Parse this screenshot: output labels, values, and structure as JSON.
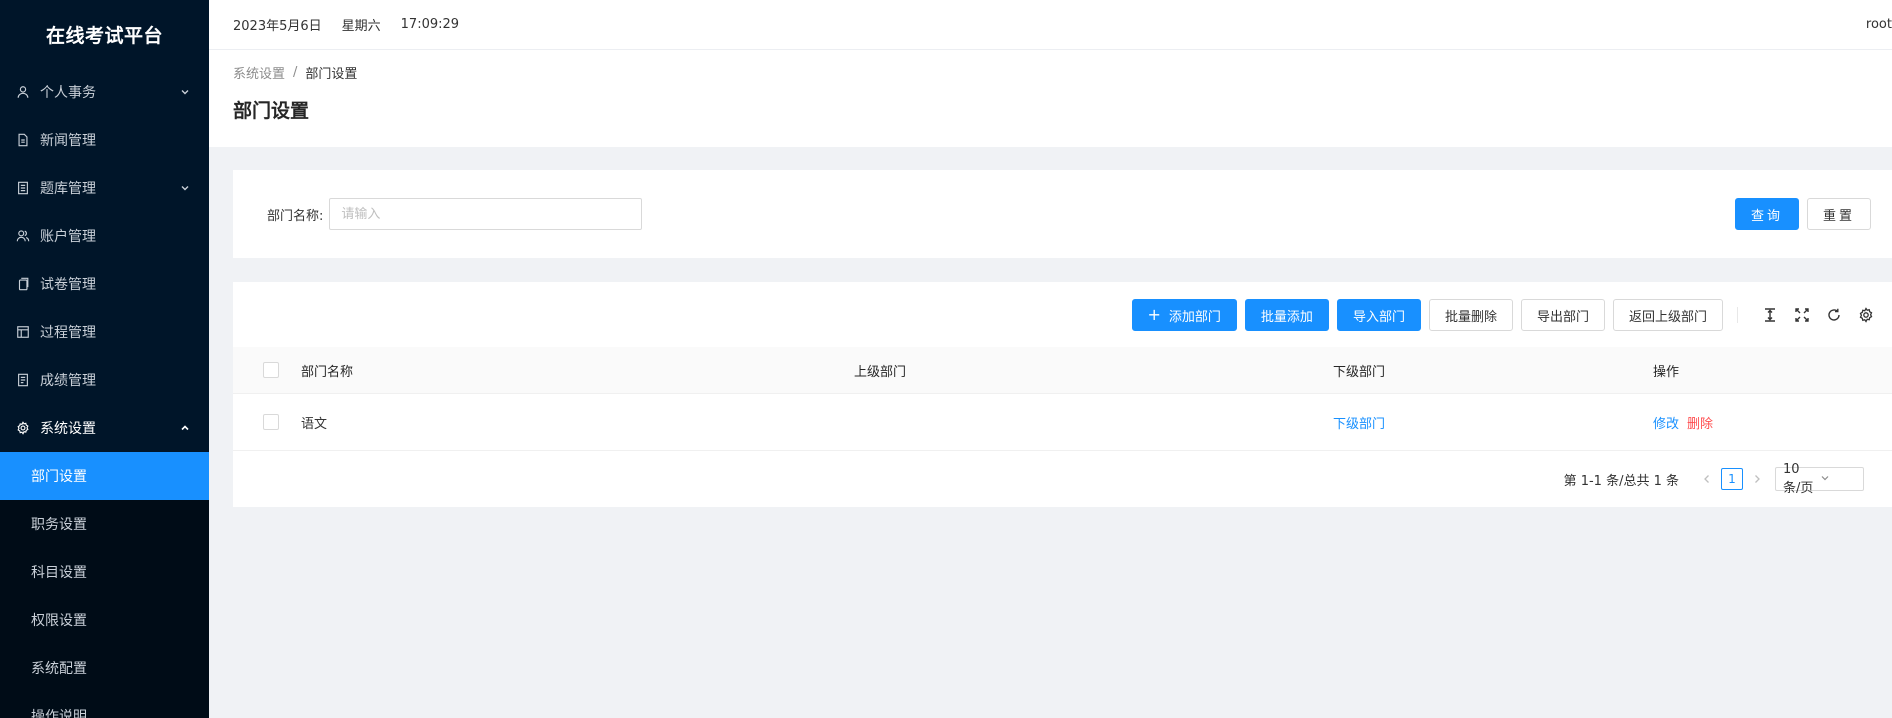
{
  "app": {
    "title": "在线考试平台"
  },
  "sidebar": {
    "items": [
      {
        "label": "个人事务",
        "icon": "user-icon",
        "has_children": true,
        "open": false
      },
      {
        "label": "新闻管理",
        "icon": "file-icon",
        "has_children": false
      },
      {
        "label": "题库管理",
        "icon": "book-icon",
        "has_children": true,
        "open": false
      },
      {
        "label": "账户管理",
        "icon": "users-icon",
        "has_children": false
      },
      {
        "label": "试卷管理",
        "icon": "copy-icon",
        "has_children": false
      },
      {
        "label": "过程管理",
        "icon": "layout-icon",
        "has_children": false
      },
      {
        "label": "成绩管理",
        "icon": "report-icon",
        "has_children": false
      },
      {
        "label": "系统设置",
        "icon": "gear-icon",
        "has_children": true,
        "open": true
      }
    ],
    "submenu": [
      {
        "label": "部门设置",
        "active": true
      },
      {
        "label": "职务设置"
      },
      {
        "label": "科目设置"
      },
      {
        "label": "权限设置"
      },
      {
        "label": "系统配置"
      },
      {
        "label": "操作说明"
      }
    ]
  },
  "header": {
    "date": "2023年5月6日",
    "weekday": "星期六",
    "time": "17:09:29",
    "user": "root"
  },
  "breadcrumb": {
    "parent": "系统设置",
    "separator": "/",
    "current": "部门设置"
  },
  "page": {
    "title": "部门设置"
  },
  "search": {
    "label": "部门名称:",
    "placeholder": "请输入",
    "value": "",
    "query_label": "查询",
    "reset_label": "重置"
  },
  "toolbar": {
    "add_label": "添加部门",
    "batch_add_label": "批量添加",
    "import_label": "导入部门",
    "batch_delete_label": "批量删除",
    "export_label": "导出部门",
    "back_label": "返回上级部门"
  },
  "table": {
    "columns": {
      "name": "部门名称",
      "parent": "上级部门",
      "child": "下级部门",
      "op": "操作"
    },
    "rows": [
      {
        "name": "语文",
        "parent": "",
        "child": "下级部门",
        "edit": "修改",
        "delete": "删除"
      }
    ]
  },
  "pagination": {
    "total_text": "第 1-1 条/总共 1 条",
    "current_page": "1",
    "page_size": "10 条/页"
  },
  "colors": {
    "primary": "#1890ff",
    "danger": "#ff4d4f",
    "sidebar_bg": "#001529"
  }
}
